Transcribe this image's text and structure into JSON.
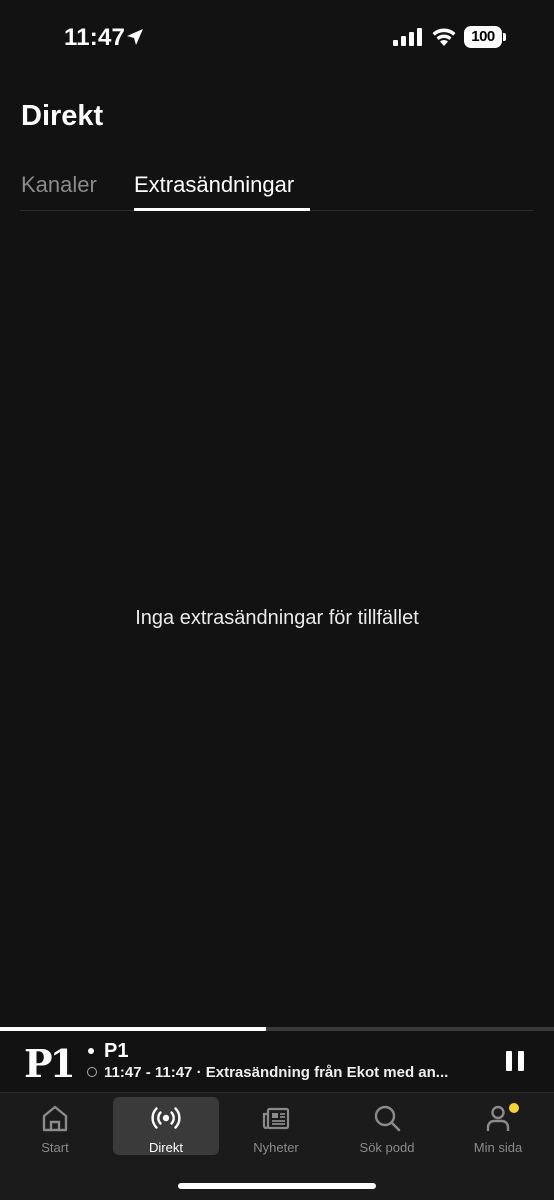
{
  "status_bar": {
    "time": "11:47",
    "battery": "100"
  },
  "header": {
    "title": "Direkt"
  },
  "tabs": [
    {
      "label": "Kanaler",
      "active": false
    },
    {
      "label": "Extrasändningar",
      "active": true
    }
  ],
  "empty_message": "Inga extrasändningar för tillfället",
  "player": {
    "channel": "P1",
    "episode": "11:47 - 11:47 · Extrasändning från Ekot med an...",
    "progress": 0.48,
    "logo_text": "P1"
  },
  "nav": [
    {
      "label": "Start",
      "icon": "home-icon",
      "active": false
    },
    {
      "label": "Direkt",
      "icon": "broadcast-icon",
      "active": true
    },
    {
      "label": "Nyheter",
      "icon": "newspaper-icon",
      "active": false
    },
    {
      "label": "Sök podd",
      "icon": "search-icon",
      "active": false
    },
    {
      "label": "Min sida",
      "icon": "user-icon",
      "active": false,
      "notification": true
    }
  ],
  "colors": {
    "background": "#121212",
    "tabbar": "#1b1b1b",
    "inactive": "#8a8a8a",
    "notification": "#f5d13a"
  }
}
